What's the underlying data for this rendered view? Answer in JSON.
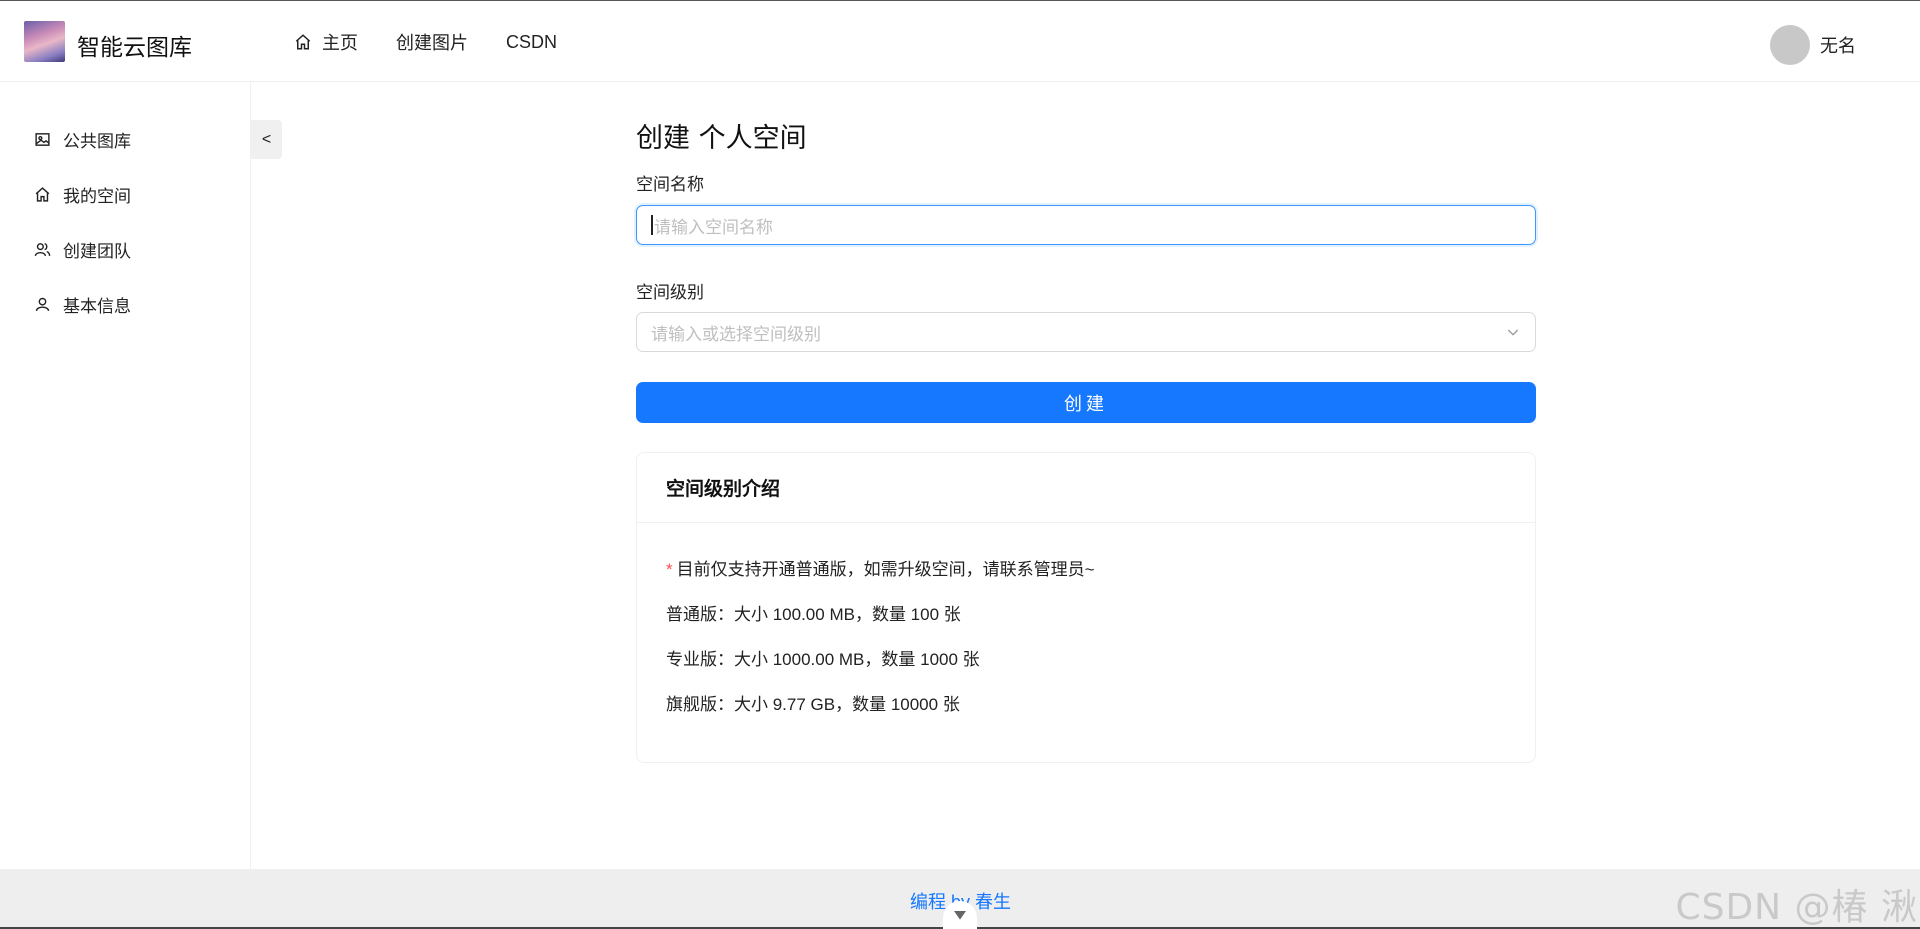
{
  "header": {
    "brand": "智能云图库",
    "nav": [
      {
        "label": "主页",
        "icon": "home-icon"
      },
      {
        "label": "创建图片"
      },
      {
        "label": "CSDN"
      }
    ],
    "user_name": "无名"
  },
  "sidebar": {
    "items": [
      {
        "label": "公共图库",
        "icon": "picture-icon"
      },
      {
        "label": "我的空间",
        "icon": "home-icon"
      },
      {
        "label": "创建团队",
        "icon": "team-icon"
      },
      {
        "label": "基本信息",
        "icon": "user-icon"
      }
    ],
    "collapse_label": "<"
  },
  "main": {
    "title": "创建 个人空间",
    "space_name_label": "空间名称",
    "space_name_placeholder": "请输入空间名称",
    "space_level_label": "空间级别",
    "space_level_placeholder": "请输入或选择空间级别",
    "create_button": "创建",
    "intro_card": {
      "title": "空间级别介绍",
      "notice_star": "*",
      "notice": "目前仅支持开通普通版，如需升级空间，请联系管理员~",
      "levels": [
        "普通版：大小 100.00 MB，数量 100 张",
        "专业版：大小 1000.00 MB，数量 1000 张",
        "旗舰版：大小 9.77 GB，数量 10000 张"
      ]
    }
  },
  "footer": {
    "credit": "编程 by 春生",
    "watermark": "CSDN @椿  湫"
  },
  "colors": {
    "primary": "#1677ff",
    "focus_border": "#4096ff",
    "required_star": "#ff4d4f"
  }
}
